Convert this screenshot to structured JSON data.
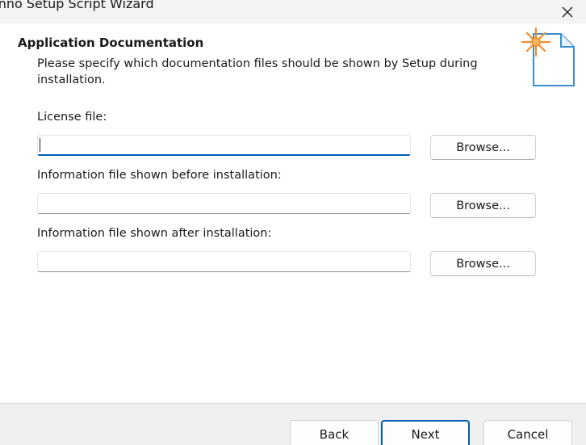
{
  "window": {
    "title": "Inno Setup Script Wizard"
  },
  "header": {
    "title": "Application Documentation",
    "description": "Please specify which documentation files should be shown by Setup during installation.",
    "icon": "document-sparkle-icon"
  },
  "fields": [
    {
      "label": "License file:",
      "value": "",
      "browse_label": "Browse..."
    },
    {
      "label": "Information file shown before installation:",
      "value": "",
      "browse_label": "Browse..."
    },
    {
      "label": "Information file shown after installation:",
      "value": "",
      "browse_label": "Browse..."
    }
  ],
  "footer": {
    "back_label": "Back",
    "next_label": "Next",
    "cancel_label": "Cancel"
  },
  "colors": {
    "accent": "#005fb8",
    "titlebar": "#f3f3f3",
    "footer": "#f0f0f0",
    "icon_accent": "#f28c28",
    "icon_blue": "#3a8fd0"
  }
}
